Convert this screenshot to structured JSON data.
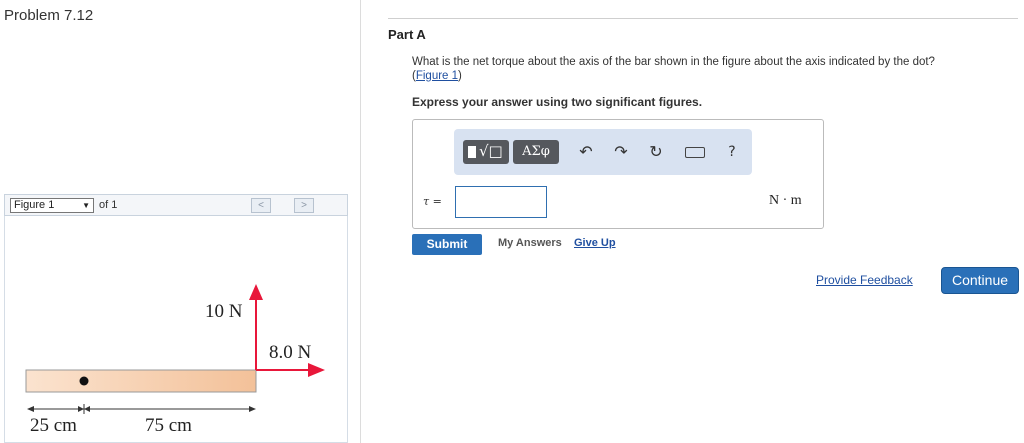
{
  "problem": {
    "title": "Problem 7.12"
  },
  "figure_nav": {
    "selected": "Figure 1",
    "of_text": "of 1",
    "prev": "<",
    "next": ">"
  },
  "figure": {
    "force_up_label": "10 N",
    "force_right_label": "8.0 N",
    "dim_left_label": "25 cm",
    "dim_right_label": "75 cm",
    "colors": {
      "bar": "#f6c7a1",
      "arrow": "#e8173a"
    }
  },
  "part": {
    "label": "Part A",
    "question": "What is the net torque about the axis of the bar shown in the figure about the axis indicated by the dot?",
    "figure_link": "Figure 1",
    "instruction": "Express your answer using two significant figures."
  },
  "toolbar": {
    "template_icon": "template-sqrt-icon",
    "greek_label": "ΑΣφ",
    "undo_icon": "↶",
    "redo_icon": "↷",
    "reset_icon": "↻",
    "keyboard_icon": "keyboard-icon",
    "help_label": "?"
  },
  "answer": {
    "variable": "τ =",
    "value": "",
    "unit": "N · m"
  },
  "actions": {
    "submit": "Submit",
    "my_answers": "My Answers",
    "give_up": "Give Up",
    "feedback": "Provide Feedback",
    "continue": "Continue"
  }
}
